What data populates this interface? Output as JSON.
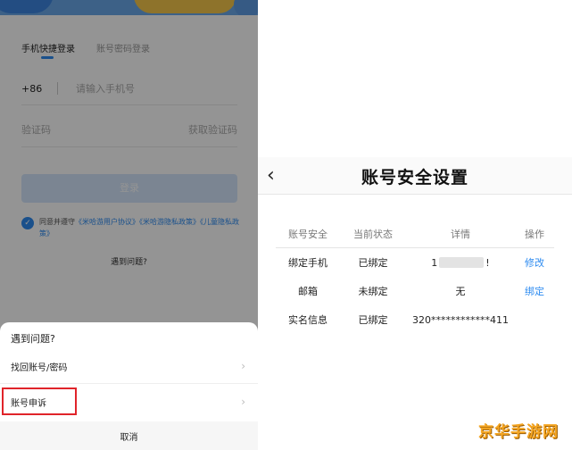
{
  "login": {
    "tabs": [
      "手机快捷登录",
      "账号密码登录"
    ],
    "country_code": "+86",
    "phone_placeholder": "请输入手机号",
    "code_placeholder": "验证码",
    "get_code": "获取验证码",
    "login_button": "登录",
    "agreement": {
      "prefix": "同意并遵守",
      "links": [
        "《米哈游用户协议》",
        "《米哈游隐私政策》",
        "《儿童隐私政策》"
      ]
    },
    "trouble_link": "遇到问题?"
  },
  "sheet": {
    "title": "遇到问题?",
    "items": [
      "找回账号/密码",
      "账号申诉"
    ],
    "cancel": "取消"
  },
  "security": {
    "title": "账号安全设置",
    "columns": [
      "账号安全",
      "当前状态",
      "详情",
      "操作"
    ],
    "rows": [
      {
        "item": "绑定手机",
        "status": "已绑定",
        "detail_prefix": "1",
        "detail_suffix": "!",
        "action": "修改"
      },
      {
        "item": "邮箱",
        "status": "未绑定",
        "detail": "无",
        "action": "绑定"
      },
      {
        "item": "实名信息",
        "status": "已绑定",
        "detail": "320************411",
        "action": ""
      }
    ]
  },
  "watermark": "京华手游网",
  "colors": {
    "accent": "#2d8bf0",
    "highlight": "#e0242a",
    "logo": "#f5a623"
  },
  "icons": {
    "back": "chevron-left-icon",
    "chevron": "chevron-right-icon",
    "check": "check-circle-icon"
  }
}
